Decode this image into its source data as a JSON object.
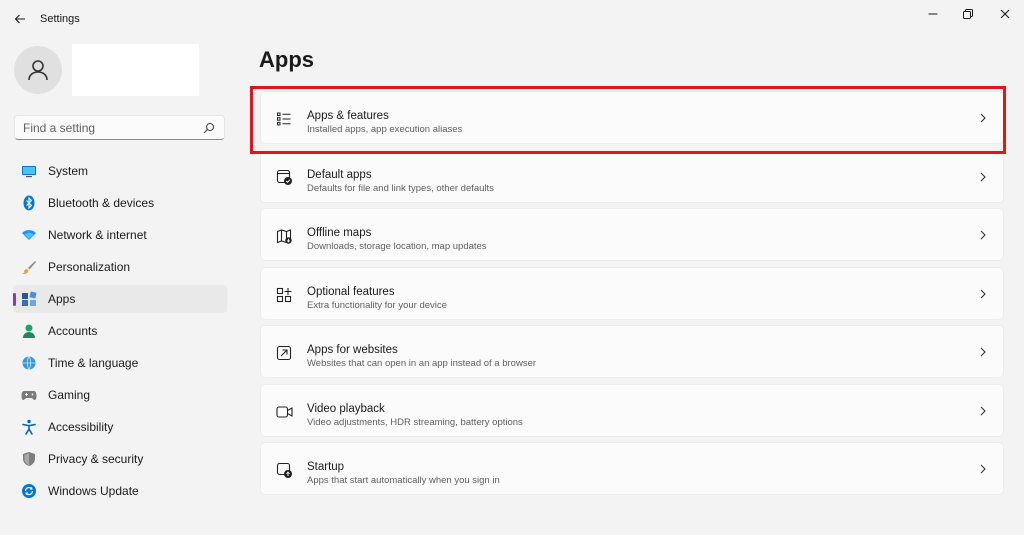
{
  "window": {
    "title": "Settings",
    "highlight_color": "#e1151c",
    "accent_color": "#7b3fb8"
  },
  "search": {
    "placeholder": "Find a setting"
  },
  "sidebar": {
    "items": [
      {
        "label": "System",
        "icon": "system-icon",
        "selected": false
      },
      {
        "label": "Bluetooth & devices",
        "icon": "bluetooth-icon",
        "selected": false
      },
      {
        "label": "Network & internet",
        "icon": "wifi-icon",
        "selected": false
      },
      {
        "label": "Personalization",
        "icon": "brush-icon",
        "selected": false
      },
      {
        "label": "Apps",
        "icon": "apps-icon",
        "selected": true
      },
      {
        "label": "Accounts",
        "icon": "accounts-icon",
        "selected": false
      },
      {
        "label": "Time & language",
        "icon": "time-language-icon",
        "selected": false
      },
      {
        "label": "Gaming",
        "icon": "gaming-icon",
        "selected": false
      },
      {
        "label": "Accessibility",
        "icon": "accessibility-icon",
        "selected": false
      },
      {
        "label": "Privacy & security",
        "icon": "shield-icon",
        "selected": false
      },
      {
        "label": "Windows Update",
        "icon": "update-icon",
        "selected": false
      }
    ]
  },
  "main": {
    "title": "Apps",
    "cards": [
      {
        "title": "Apps & features",
        "subtitle": "Installed apps, app execution aliases",
        "icon": "list-icon",
        "highlighted": true
      },
      {
        "title": "Default apps",
        "subtitle": "Defaults for file and link types, other defaults",
        "icon": "default-apps-icon",
        "highlighted": false
      },
      {
        "title": "Offline maps",
        "subtitle": "Downloads, storage location, map updates",
        "icon": "map-icon",
        "highlighted": false
      },
      {
        "title": "Optional features",
        "subtitle": "Extra functionality for your device",
        "icon": "grid-add-icon",
        "highlighted": false
      },
      {
        "title": "Apps for websites",
        "subtitle": "Websites that can open in an app instead of a browser",
        "icon": "open-external-icon",
        "highlighted": false
      },
      {
        "title": "Video playback",
        "subtitle": "Video adjustments, HDR streaming, battery options",
        "icon": "video-icon",
        "highlighted": false
      },
      {
        "title": "Startup",
        "subtitle": "Apps that start automatically when you sign in",
        "icon": "startup-icon",
        "highlighted": false
      }
    ]
  }
}
